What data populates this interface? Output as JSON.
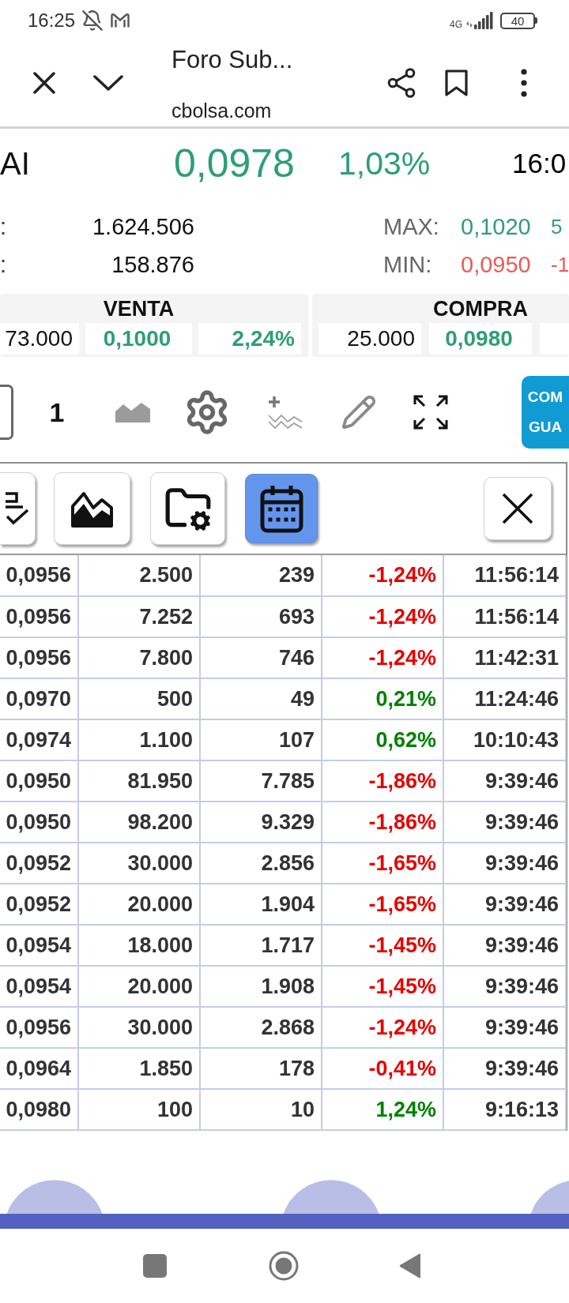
{
  "status_bar": {
    "time": "16:25",
    "network": "4G",
    "battery": "40"
  },
  "browser": {
    "title": "Foro Sub...",
    "url": "cbolsa.com"
  },
  "quote": {
    "symbol": "AI",
    "price": "0,0978",
    "change": "1,03%",
    "time": "16:0",
    "positive": true
  },
  "stats": [
    {
      "label": ":",
      "value": "1.624.506",
      "range_label": "MAX:",
      "range_value": "0,1020",
      "range_extra": "5",
      "positive": true
    },
    {
      "label": ":",
      "value": "158.876",
      "range_label": "MIN:",
      "range_value": "0,0950",
      "range_extra": "-1",
      "positive": false
    }
  ],
  "order_book": [
    {
      "title": "VENTA",
      "volume": "73.000",
      "price": "0,1000",
      "change": "2,24%",
      "positive": true
    },
    {
      "title": "COMPRA",
      "volume": "25.000",
      "price": "0,0980",
      "positive": true
    }
  ],
  "toolbar": {
    "period": "1",
    "action_button": [
      "COM",
      "GUA"
    ]
  },
  "chart_tabs": [
    {
      "kind": "checklist",
      "selected": false
    },
    {
      "kind": "area",
      "selected": false
    },
    {
      "kind": "folder",
      "selected": false
    },
    {
      "kind": "calendar",
      "selected": true
    }
  ],
  "table": {
    "rows": [
      {
        "cells": [
          "0,0956",
          "2.500",
          "239",
          "-1,24%",
          "11:56:14"
        ],
        "positive": false
      },
      {
        "cells": [
          "0,0956",
          "7.252",
          "693",
          "-1,24%",
          "11:56:14"
        ],
        "positive": false
      },
      {
        "cells": [
          "0,0956",
          "7.800",
          "746",
          "-1,24%",
          "11:42:31"
        ],
        "positive": false
      },
      {
        "cells": [
          "0,0970",
          "500",
          "49",
          "0,21%",
          "11:24:46"
        ],
        "positive": true
      },
      {
        "cells": [
          "0,0974",
          "1.100",
          "107",
          "0,62%",
          "10:10:43"
        ],
        "positive": true
      },
      {
        "cells": [
          "0,0950",
          "81.950",
          "7.785",
          "-1,86%",
          "9:39:46"
        ],
        "positive": false
      },
      {
        "cells": [
          "0,0950",
          "98.200",
          "9.329",
          "-1,86%",
          "9:39:46"
        ],
        "positive": false
      },
      {
        "cells": [
          "0,0952",
          "30.000",
          "2.856",
          "-1,65%",
          "9:39:46"
        ],
        "positive": false
      },
      {
        "cells": [
          "0,0952",
          "20.000",
          "1.904",
          "-1,65%",
          "9:39:46"
        ],
        "positive": false
      },
      {
        "cells": [
          "0,0954",
          "18.000",
          "1.717",
          "-1,45%",
          "9:39:46"
        ],
        "positive": false
      },
      {
        "cells": [
          "0,0954",
          "20.000",
          "1.908",
          "-1,45%",
          "9:39:46"
        ],
        "positive": false
      },
      {
        "cells": [
          "0,0956",
          "30.000",
          "2.868",
          "-1,24%",
          "9:39:46"
        ],
        "positive": false
      },
      {
        "cells": [
          "0,0964",
          "1.850",
          "178",
          "-0,41%",
          "9:39:46"
        ],
        "positive": false
      },
      {
        "cells": [
          "0,0980",
          "100",
          "10",
          "1,24%",
          "9:16:13"
        ],
        "positive": true
      }
    ]
  }
}
